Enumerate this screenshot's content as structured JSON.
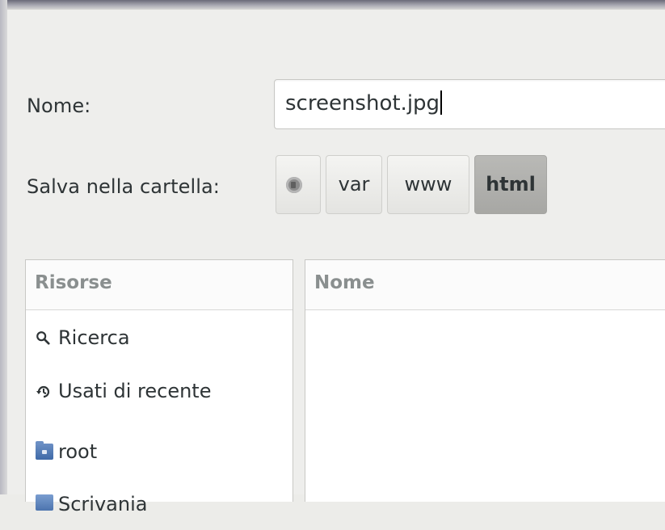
{
  "dialog": {
    "name_label": "Nome:",
    "filename_value": "screenshot.jpg",
    "folder_label": "Salva nella cartella:",
    "path_crumbs": [
      {
        "label": "",
        "icon": "home-icon"
      },
      {
        "label": "var"
      },
      {
        "label": "www"
      },
      {
        "label": "html",
        "active": true
      }
    ]
  },
  "sidebar": {
    "header": "Risorse",
    "items": [
      {
        "label": "Ricerca",
        "icon": "search-icon"
      },
      {
        "label": "Usati di recente",
        "icon": "recent-icon"
      },
      {
        "label": "root",
        "icon": "folder-home-icon"
      },
      {
        "label": "Scrivania",
        "icon": "desktop-folder-icon"
      }
    ]
  },
  "filelist": {
    "column_name": "Nome"
  }
}
